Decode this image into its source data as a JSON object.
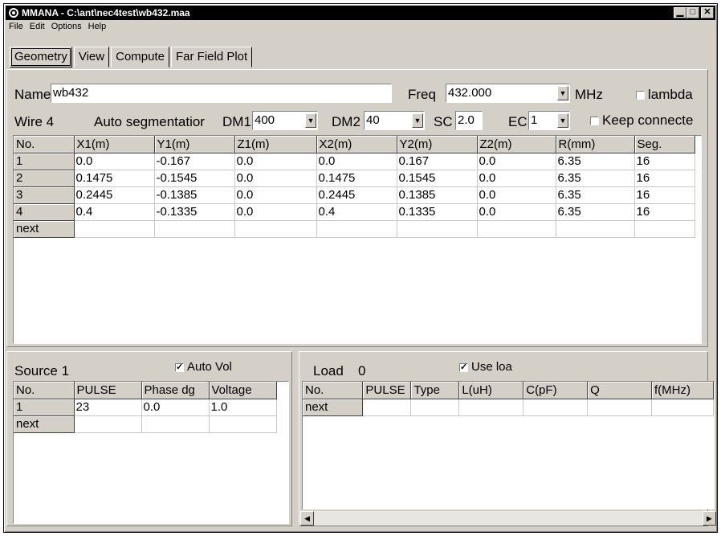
{
  "window": {
    "title": "MMANA - C:\\ant\\nec4test\\wb432.maa",
    "minimize": "▁",
    "maximize": "□",
    "close": "✕"
  },
  "menu": [
    "File",
    "Edit",
    "Options",
    "Help"
  ],
  "tabs": [
    "Geometry",
    "View",
    "Compute",
    "Far Field Plot"
  ],
  "active_tab": "Geometry",
  "geometry": {
    "name_label": "Name",
    "name_value": "wb432",
    "freq_label": "Freq",
    "freq_value": "432.000",
    "freq_unit": "MHz",
    "lambda_label": "lambda",
    "lambda_checked": false,
    "wire_label": "Wire 4",
    "autoseg_label": "Auto segmentatior",
    "dm1_label": "DM1",
    "dm1_value": "400",
    "dm2_label": "DM2",
    "dm2_value": "40",
    "sc_label": "SC",
    "sc_value": "2.0",
    "ec_label": "EC",
    "ec_value": "1",
    "keep_label": "Keep connecte",
    "keep_checked": false,
    "wire_columns": [
      "No.",
      "X1(m)",
      "Y1(m)",
      "Z1(m)",
      "X2(m)",
      "Y2(m)",
      "Z2(m)",
      "R(mm)",
      "Seg."
    ],
    "wire_rows": [
      [
        "1",
        "0.0",
        "-0.167",
        "0.0",
        "0.0",
        "0.167",
        "0.0",
        "6.35",
        "16"
      ],
      [
        "2",
        "0.1475",
        "-0.1545",
        "0.0",
        "0.1475",
        "0.1545",
        "0.0",
        "6.35",
        "16"
      ],
      [
        "3",
        "0.2445",
        "-0.1385",
        "0.0",
        "0.2445",
        "0.1385",
        "0.0",
        "6.35",
        "16"
      ],
      [
        "4",
        "0.4",
        "-0.1335",
        "0.0",
        "0.4",
        "0.1335",
        "0.0",
        "6.35",
        "16"
      ],
      [
        "next",
        "",
        "",
        "",
        "",
        "",
        "",
        "",
        ""
      ]
    ]
  },
  "source": {
    "label": "Source 1",
    "auto_vol_label": "Auto Vol",
    "auto_vol_checked": true,
    "columns": [
      "No.",
      "PULSE",
      "Phase dg",
      "Voltage"
    ],
    "rows": [
      [
        "1",
        "23",
        "0.0",
        "1.0"
      ],
      [
        "next",
        "",
        "",
        ""
      ]
    ]
  },
  "load": {
    "label": "Load",
    "count": "0",
    "use_load_label": "Use loa",
    "use_load_checked": true,
    "columns": [
      "No.",
      "PULSE",
      "Type",
      "L(uH)",
      "C(pF)",
      "Q",
      "f(MHz)"
    ],
    "rows": [
      [
        "next",
        "",
        "",
        "",
        "",
        "",
        ""
      ]
    ],
    "scroll_left": "◀",
    "scroll_right": "▶"
  },
  "check_mark": "✓",
  "dropdown_arrow": "▼"
}
